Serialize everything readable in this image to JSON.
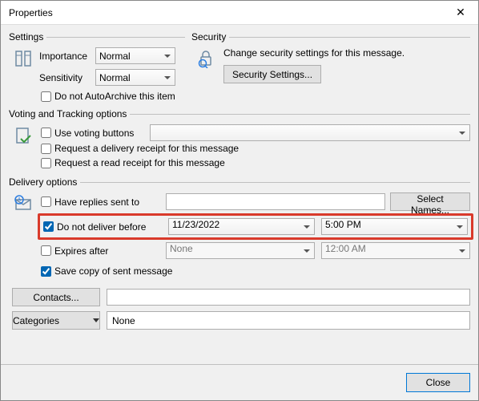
{
  "window": {
    "title": "Properties"
  },
  "settings": {
    "legend": "Settings",
    "importance_label": "Importance",
    "importance_value": "Normal",
    "sensitivity_label": "Sensitivity",
    "sensitivity_value": "Normal",
    "autoarchive_label": "Do not AutoArchive this item",
    "autoarchive_checked": false
  },
  "security": {
    "legend": "Security",
    "text": "Change security settings for this message.",
    "button": "Security Settings..."
  },
  "voting": {
    "legend": "Voting and Tracking options",
    "use_voting_label": "Use voting buttons",
    "use_voting_checked": false,
    "voting_value": "",
    "delivery_receipt_label": "Request a delivery receipt for this message",
    "delivery_receipt_checked": false,
    "read_receipt_label": "Request a read receipt for this message",
    "read_receipt_checked": false
  },
  "delivery": {
    "legend": "Delivery options",
    "replies_label": "Have replies sent to",
    "replies_checked": false,
    "replies_value": "",
    "select_names": "Select Names...",
    "dnd_label": "Do not deliver before",
    "dnd_checked": true,
    "dnd_date": "11/23/2022",
    "dnd_time": "5:00 PM",
    "expires_label": "Expires after",
    "expires_checked": false,
    "expires_date": "None",
    "expires_time": "12:00 AM",
    "savecopy_label": "Save copy of sent message",
    "savecopy_checked": true
  },
  "bottom": {
    "contacts_btn": "Contacts...",
    "contacts_value": "",
    "categories_btn": "Categories",
    "categories_value": "None"
  },
  "footer": {
    "close": "Close"
  }
}
